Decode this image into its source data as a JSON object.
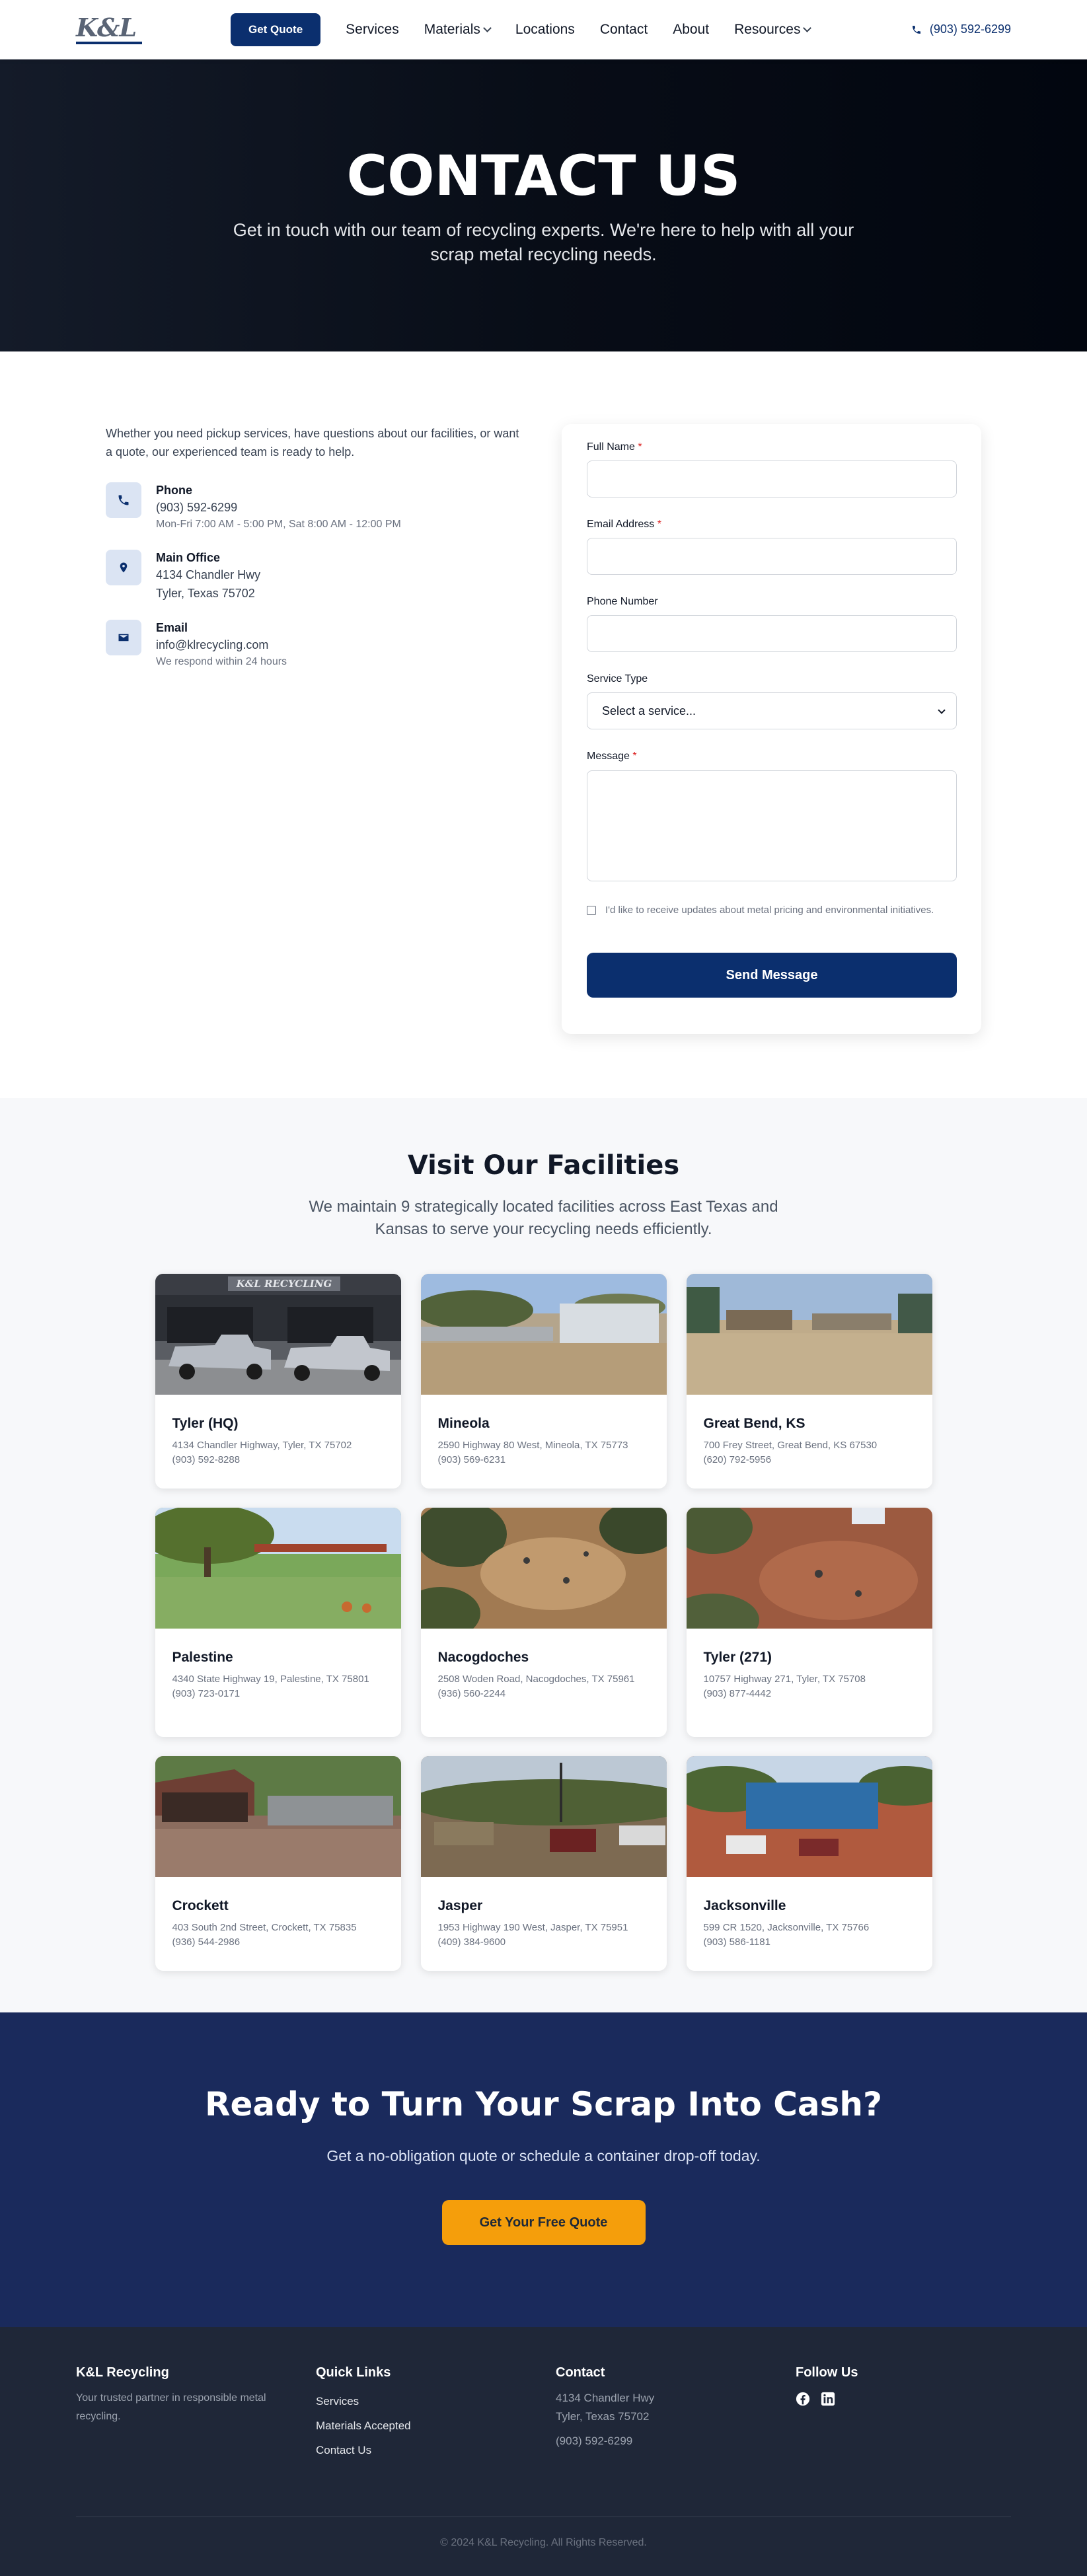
{
  "nav": {
    "logo_text": "K&L",
    "cta": "Get Quote",
    "links": [
      {
        "label": "Services",
        "dropdown": false
      },
      {
        "label": "Materials",
        "dropdown": true
      },
      {
        "label": "Locations",
        "dropdown": false
      },
      {
        "label": "Contact",
        "dropdown": false
      },
      {
        "label": "About",
        "dropdown": false
      },
      {
        "label": "Resources",
        "dropdown": true
      }
    ],
    "phone": "(903) 592-6299"
  },
  "hero": {
    "title": "CONTACT US",
    "subtitle": "Get in touch with our team of recycling experts. We're here to help with all your scrap metal recycling needs."
  },
  "contact": {
    "intro": "Whether you need pickup services, have questions about our facilities, or want a quote, our experienced team is ready to help.",
    "items": [
      {
        "icon": "phone-icon",
        "title": "Phone",
        "lines": [
          "(903) 592-6299"
        ],
        "sub": "Mon-Fri 7:00 AM - 5:00 PM, Sat 8:00 AM - 12:00 PM"
      },
      {
        "icon": "map-pin-icon",
        "title": "Main Office",
        "lines": [
          "4134 Chandler Hwy",
          "Tyler, Texas 75702"
        ],
        "sub": ""
      },
      {
        "icon": "envelope-icon",
        "title": "Email",
        "lines": [
          "info@klrecycling.com"
        ],
        "sub": "We respond within 24 hours"
      }
    ]
  },
  "form": {
    "full_name_label": "Full Name",
    "email_label": "Email Address",
    "phone_label": "Phone Number",
    "service_label": "Service Type",
    "service_value": "Select a service...",
    "message_label": "Message",
    "required_mark": "*",
    "newsletter_text": "I'd like to receive updates about metal pricing and environmental initiatives.",
    "submit": "Send Message"
  },
  "facilities": {
    "title": "Visit Our Facilities",
    "subtitle": "We maintain 9 strategically located facilities across East Texas and Kansas to serve your recycling needs efficiently.",
    "items": [
      {
        "name": "Tyler (HQ)",
        "address": "4134 Chandler Highway, Tyler, TX 75702",
        "phone": "(903) 592-8288",
        "sign": "K&L RECYCLING"
      },
      {
        "name": "Mineola",
        "address": "2590 Highway 80 West, Mineola, TX 75773",
        "phone": "(903) 569-6231"
      },
      {
        "name": "Great Bend, KS",
        "address": "700 Frey Street, Great Bend, KS 67530",
        "phone": "(620) 792-5956"
      },
      {
        "name": "Palestine",
        "address": "4340 State Highway 19, Palestine, TX 75801",
        "phone": "(903) 723-0171"
      },
      {
        "name": "Nacogdoches",
        "address": "2508 Woden Road, Nacogdoches, TX 75961",
        "phone": "(936) 560-2244"
      },
      {
        "name": "Tyler (271)",
        "address": "10757 Highway 271, Tyler, TX 75708",
        "phone": "(903) 877-4442"
      },
      {
        "name": "Crockett",
        "address": "403 South 2nd Street, Crockett, TX 75835",
        "phone": "(936) 544-2986"
      },
      {
        "name": "Jasper",
        "address": "1953 Highway 190 West, Jasper, TX 75951",
        "phone": "(409) 384-9600"
      },
      {
        "name": "Jacksonville",
        "address": "599 CR 1520, Jacksonville, TX 75766",
        "phone": "(903) 586-1181"
      }
    ]
  },
  "cta": {
    "title": "Ready to Turn Your Scrap Into Cash?",
    "subtitle": "Get a no-obligation quote or schedule a container drop-off today.",
    "button": "Get Your Free Quote"
  },
  "footer": {
    "brand": "K&L Recycling",
    "tagline": "Your trusted partner in responsible metal recycling.",
    "quick_links_title": "Quick Links",
    "quick_links": [
      "Services",
      "Materials Accepted",
      "Contact Us"
    ],
    "contact_title": "Contact",
    "contact_lines": [
      "4134 Chandler Hwy",
      "Tyler, Texas 75702"
    ],
    "contact_phone": "(903) 592-6299",
    "follow_title": "Follow Us",
    "copyright": "© 2024 K&L Recycling. All Rights Reserved."
  },
  "colors": {
    "brand_navy": "#0b2f6e",
    "cta_background": "#1a2a5c",
    "accent_orange": "#f59e0b",
    "footer_background": "#1f2738",
    "required_red": "#dc2626"
  }
}
